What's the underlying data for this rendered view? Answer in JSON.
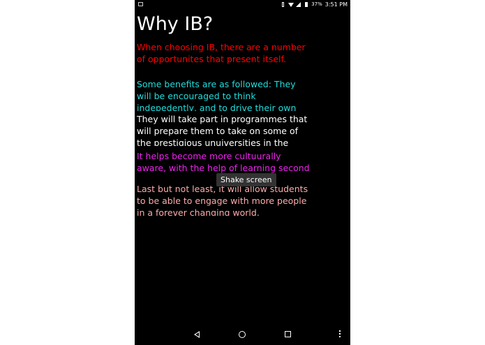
{
  "status_bar": {
    "battery_percent": "37%",
    "time": "3:51 PM"
  },
  "title": "Why IB?",
  "paragraphs": [
    "When choosing IB, there are a number of opportunites that present itself.",
    "Some benefits are as followed: They will be encouraged to think indepedently, and to drive their own learning.",
    "They will take part in programmes that will prepare them to take on some of the prestigious unuiversities in the world",
    "It helps become more cultuurally aware, with the help of learning second language",
    "Last but not least, it will allow students to be able to engage with more people in a forever changing world."
  ],
  "toast": "Shake screen",
  "colors": {
    "paragraph_1": "#ff0000",
    "paragraph_2": "#22dddd",
    "paragraph_3": "#ffffff",
    "paragraph_4": "#ee22ee",
    "paragraph_5": "#ffaaaa"
  },
  "icons": {
    "status_left": "image-notification-icon",
    "status_right": [
      "vibrate-icon",
      "wifi-icon",
      "signal-icon",
      "battery-icon"
    ],
    "nav": [
      "back-icon",
      "home-icon",
      "recents-icon",
      "overflow-menu-icon"
    ]
  }
}
